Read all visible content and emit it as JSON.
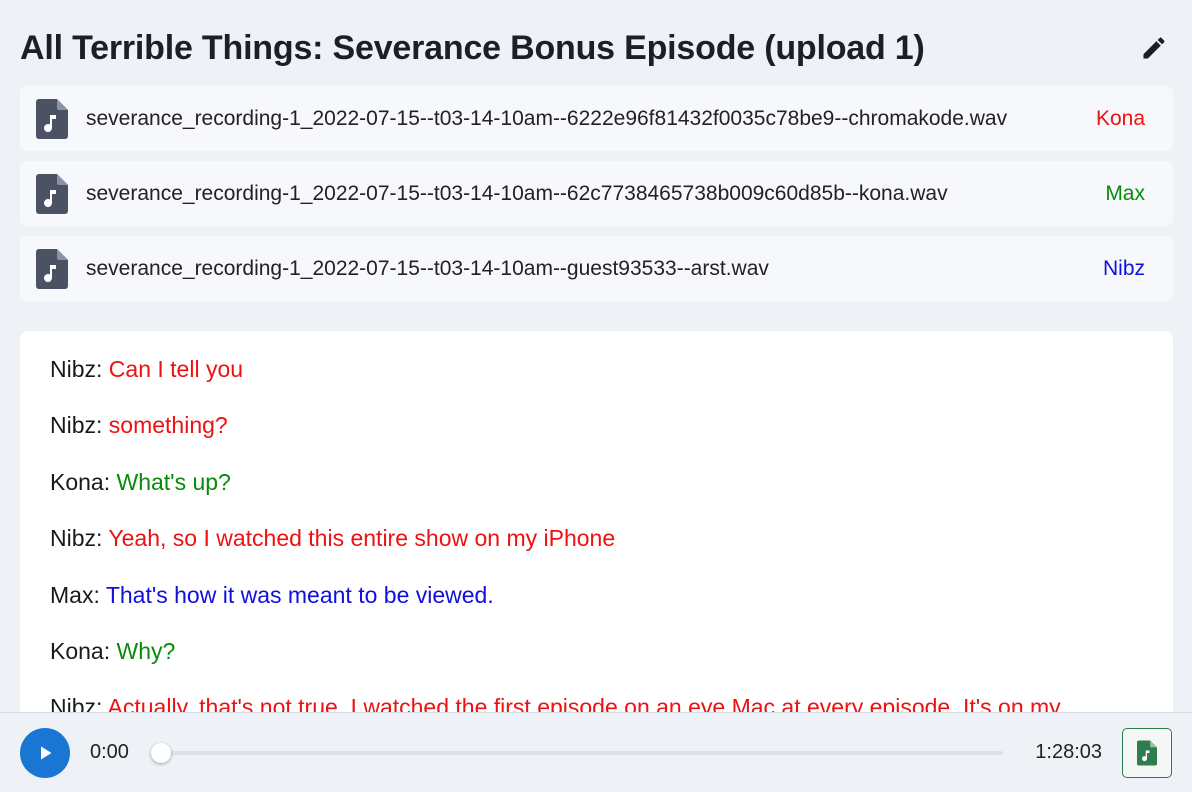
{
  "header": {
    "title": "All Terrible Things: Severance Bonus Episode (upload 1)",
    "edit_icon": "pencil-icon"
  },
  "colors": {
    "Kona": "#ee1111",
    "Max": "#0a8a0a",
    "Nibz": "#1010dd",
    "accent": "#1976d2",
    "export": "#2e7d4f"
  },
  "files": [
    {
      "name": "severance_recording-1_2022-07-15--t03-14-10am--6222e96f81432f0035c78be9--chromakode.wav",
      "speaker": "Kona",
      "color": "#ee1111",
      "icon": "audio-file-icon"
    },
    {
      "name": "severance_recording-1_2022-07-15--t03-14-10am--62c7738465738b009c60d85b--kona.wav",
      "speaker": "Max",
      "color": "#0a8a0a",
      "icon": "audio-file-icon"
    },
    {
      "name": "severance_recording-1_2022-07-15--t03-14-10am--guest93533--arst.wav",
      "speaker": "Nibz",
      "color": "#1010dd",
      "icon": "audio-file-icon"
    }
  ],
  "transcript": [
    {
      "speaker": "Nibz:",
      "text": "Can I tell you",
      "color": "#ee1111"
    },
    {
      "speaker": "Nibz:",
      "text": "something?",
      "color": "#ee1111"
    },
    {
      "speaker": "Kona:",
      "text": "What's up?",
      "color": "#0a8a0a"
    },
    {
      "speaker": "Nibz:",
      "text": "Yeah, so I watched this entire show on my iPhone",
      "color": "#ee1111"
    },
    {
      "speaker": "Max:",
      "text": "That's how it was meant to be viewed.",
      "color": "#1010dd"
    },
    {
      "speaker": "Kona:",
      "text": "Why?",
      "color": "#0a8a0a"
    },
    {
      "speaker": "Nibz:",
      "text": "Actually, that's not true. I watched the first episode on an eye Mac at every episode. It's on my",
      "color": "#ee1111"
    }
  ],
  "player": {
    "current_time": "0:00",
    "total_time": "1:28:03",
    "progress": 0,
    "play_icon": "play-icon",
    "export_icon": "audio-file-icon"
  }
}
